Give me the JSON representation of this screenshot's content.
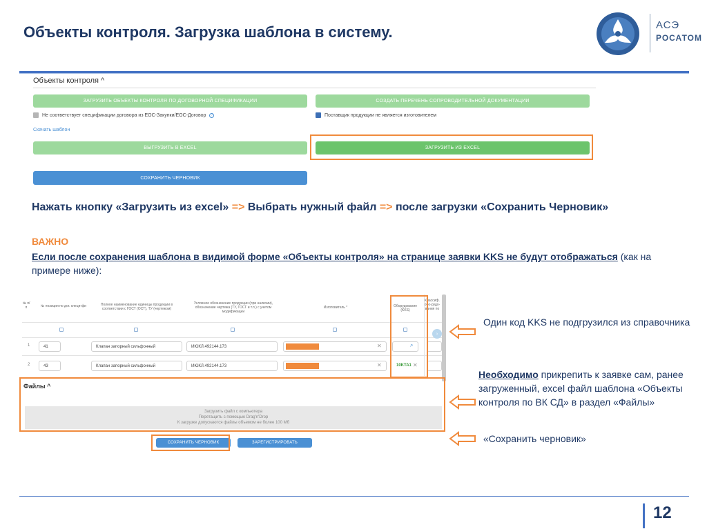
{
  "slide": {
    "title": "Объекты контроля. Загрузка шаблона в систему.",
    "page_number": "12"
  },
  "logo": {
    "line1": "АСЭ",
    "line2": "РОСАТОМ"
  },
  "form1": {
    "section_title": "Объекты контроля ^",
    "btn_upload_spec": "Загрузить объекты контроля по договорной спецификации",
    "btn_create_list": "Создать перечень сопроводительной документации",
    "checkbox_left": "Не соответствует спецификации договора из ЕОС-Закупки/ЕОС-Договор",
    "checkbox_right": "Поставщик продукции не является изготовителем",
    "download_template_link": "Скачать шаблон",
    "btn_export_excel": "Выгрузить в Excel",
    "btn_import_excel": "Загрузить из Excel",
    "btn_save_draft": "Сохранить черновик"
  },
  "instruction": {
    "part1": "Нажать кнопку «Загрузить из excel» ",
    "arrow": "=>",
    "part2": " Выбрать нужный файл ",
    "part3": " после загрузки «Сохранить Черновик»"
  },
  "warning": {
    "label": "ВАЖНО",
    "underlined": "Если после сохранения шаблона в видимой форме «Объекты контроля» на странице заявки  KKS не будут отображаться",
    "rest": " (как на примере ниже):"
  },
  "table": {
    "headers": [
      "№ п/п",
      "№ позиции по дог. специ-фи",
      "Полное наименование единицы продукции в соответствии с ГОСТ (ОСТ), ТУ (чертежом)",
      "Условное обозначение продукции (при наличии), обозначение чертежа (ТУ, ГОСТ и т.п.) с учетом модификации",
      "Изготовитель *",
      "Оборудование (KKS)",
      "Классиф. обо-рудо-вания по"
    ],
    "rows": [
      {
        "num": "1",
        "position": "41",
        "name": "Клапан запорный сильфонный",
        "designation": "ИЮКЛ.492144.173",
        "kks": ""
      },
      {
        "num": "2",
        "position": "43",
        "name": "Клапан запорный сильфонный",
        "designation": "ИЮКЛ.492144.173",
        "kks": "10KTA1"
      }
    ]
  },
  "files": {
    "title": "Файлы ^",
    "drop_line1": "Загрузить файл с компьютера",
    "drop_line2": "Перетащить с помощью Drag'n'Drop",
    "drop_line3": "К загрузке допускаются файлы объемом не более 100 Мб",
    "btn_save_draft": "Сохранить черновик",
    "btn_register": "Зарегистрировать"
  },
  "notes": {
    "note1": "Один код KKS не подгрузился из справочника",
    "note2_bold": "Необходимо",
    "note2_rest": " прикрепить к заявке сам, ранее загруженный, excel файл шаблона «Объекты контроля по ВК СД» в раздел «Файлы»",
    "note3": "«Сохранить черновик»"
  },
  "colors": {
    "title_blue": "#1f3864",
    "accent_orange": "#f08a3c",
    "rule_blue": "#4472c4",
    "green_light": "#9dd99d",
    "green_dark": "#6cc46c",
    "button_blue": "#4a90d4"
  },
  "icons": [
    "rosatom-logo-icon",
    "help-icon",
    "search-icon",
    "close-icon",
    "left-arrow-icon",
    "checkbox-icon"
  ]
}
